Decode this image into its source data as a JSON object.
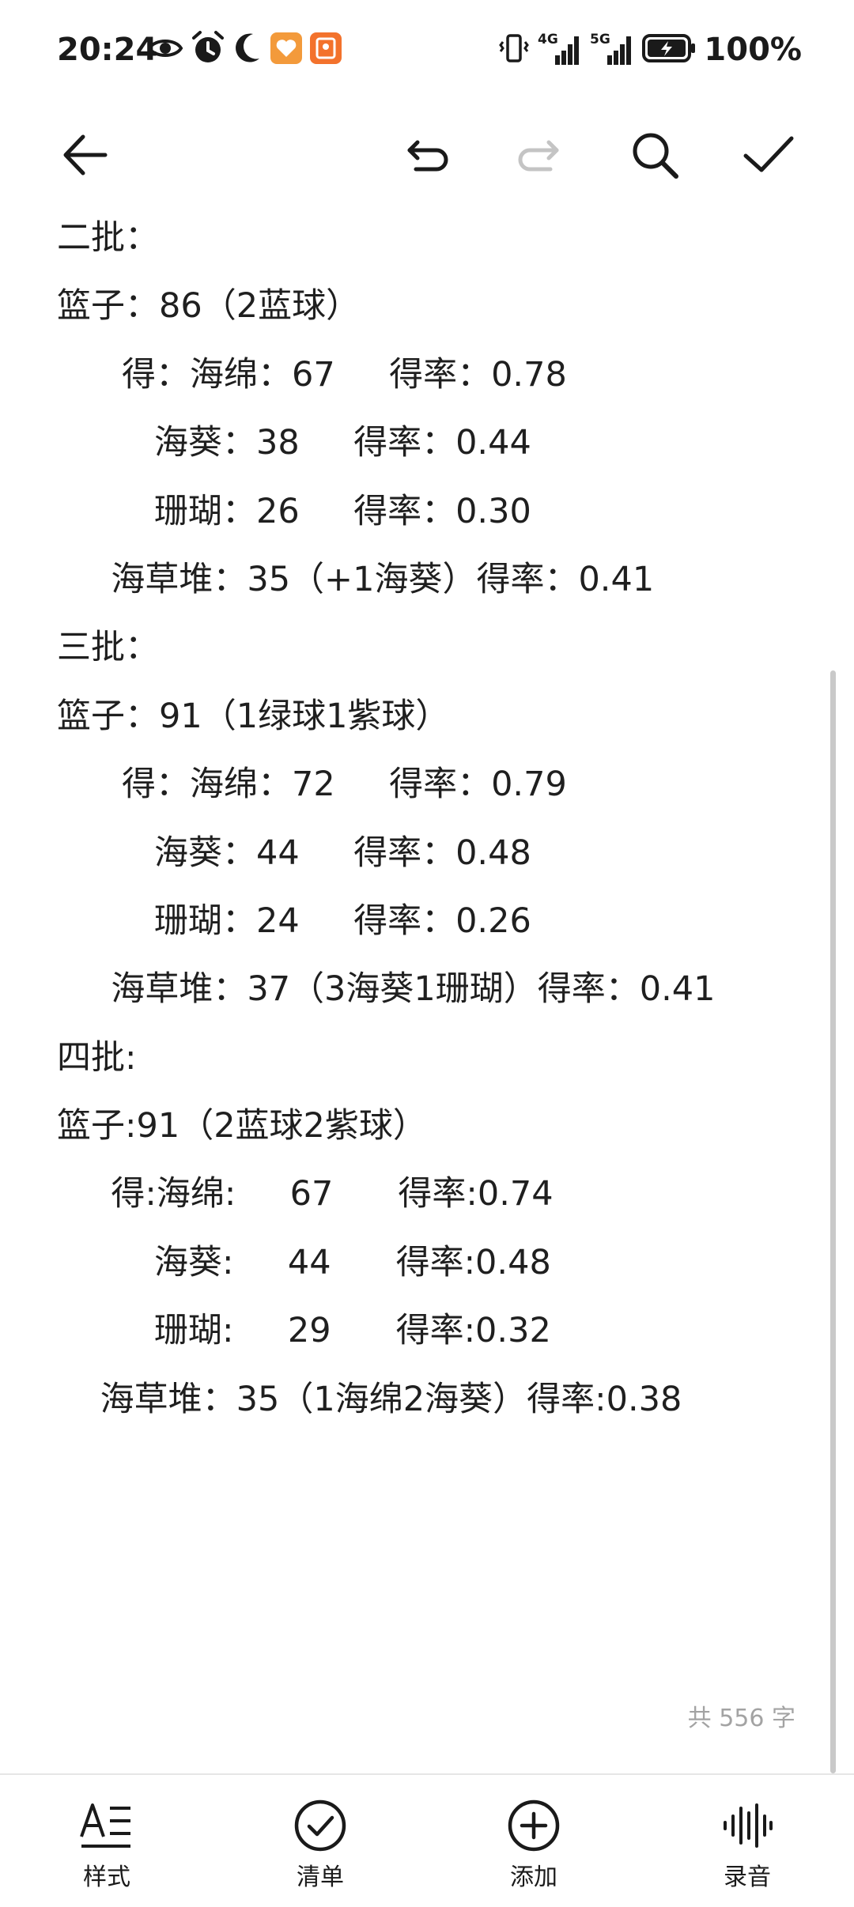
{
  "status_bar": {
    "time": "20:24",
    "left_icons": [
      "eye-icon",
      "alarm-icon",
      "moon-icon",
      "health-app-icon",
      "reader-app-icon"
    ],
    "right_icons": [
      "vibrate-icon",
      "signal-4g-icon",
      "signal-5g-icon",
      "battery-icon"
    ],
    "net_4g": "4G",
    "net_5g": "5G",
    "battery": "100%"
  },
  "toolbar": {
    "back": "back-arrow-icon",
    "undo": "undo-icon",
    "redo": "redo-icon",
    "search": "search-icon",
    "confirm": "check-icon"
  },
  "note": {
    "lines": [
      "二批：",
      "篮子：86（2蓝球）",
      "      得：海绵：67     得率：0.78",
      "         海葵：38     得率：0.44",
      "         珊瑚：26     得率：0.30",
      "     海草堆：35（+1海葵）得率：0.41",
      "三批：",
      "篮子：91（1绿球1紫球）",
      "      得：海绵：72     得率：0.79",
      "         海葵：44     得率：0.48",
      "         珊瑚：24     得率：0.26",
      "     海草堆：37（3海葵1珊瑚）得率：0.41",
      "四批:",
      "篮子:91（2蓝球2紫球）",
      "     得:海绵:     67      得率:0.74",
      "         海葵:     44      得率:0.48",
      "         珊瑚:     29      得率:0.32",
      "    海草堆：35（1海绵2海葵）得率:0.38"
    ]
  },
  "word_count": "共 556 字",
  "bottom_bar": {
    "items": [
      {
        "label": "样式",
        "icon": "text-style-icon"
      },
      {
        "label": "清单",
        "icon": "checklist-icon"
      },
      {
        "label": "添加",
        "icon": "add-icon"
      },
      {
        "label": "录音",
        "icon": "voice-record-icon"
      }
    ]
  }
}
